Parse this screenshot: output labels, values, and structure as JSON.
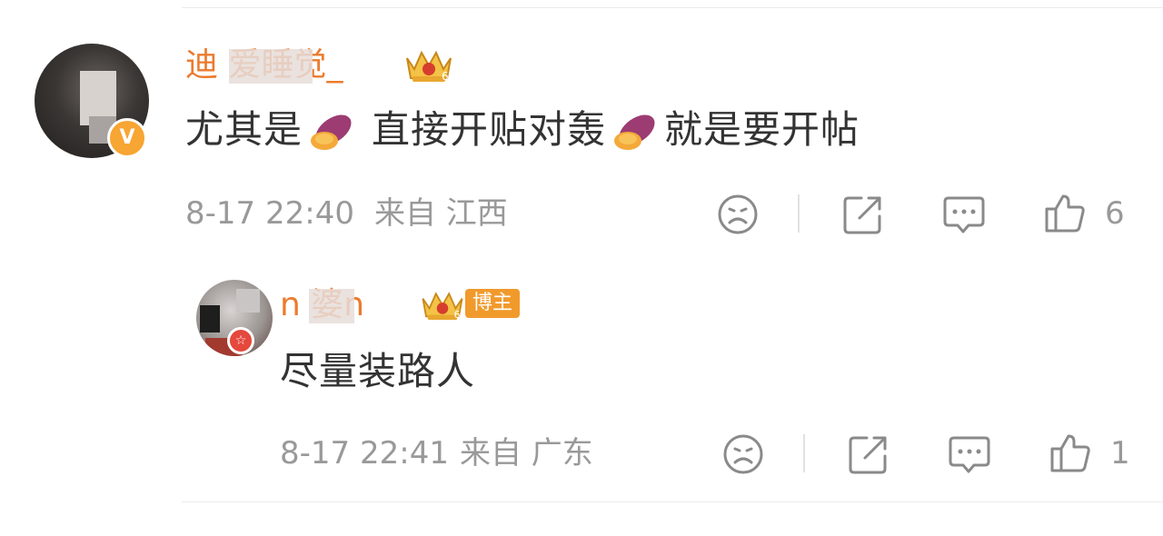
{
  "comment": {
    "username": "迪 爱睡觉_",
    "text_1": "尤其是",
    "text_2": "直接开贴对轰",
    "text_3": "就是要开帖",
    "emoji_name": "sweet-potato-icon",
    "timestamp": "8-17 22:40",
    "source": "来自 江西",
    "verified_badge": "V",
    "like_count": "6"
  },
  "reply": {
    "username": "n   婆n",
    "author_tag": "博主",
    "text": "尽量装路人",
    "timestamp": "8-17 22:41",
    "source": "来自 广东",
    "like_count": "1"
  },
  "colors": {
    "username": "#eb7b2e",
    "meta": "#999999",
    "content": "#333333",
    "badge_orange": "#f7a533",
    "badge_red": "#e5483c"
  },
  "icons": [
    "dislike-face-icon",
    "share-icon",
    "comment-icon",
    "like-thumb-icon",
    "crown-level-icon"
  ]
}
